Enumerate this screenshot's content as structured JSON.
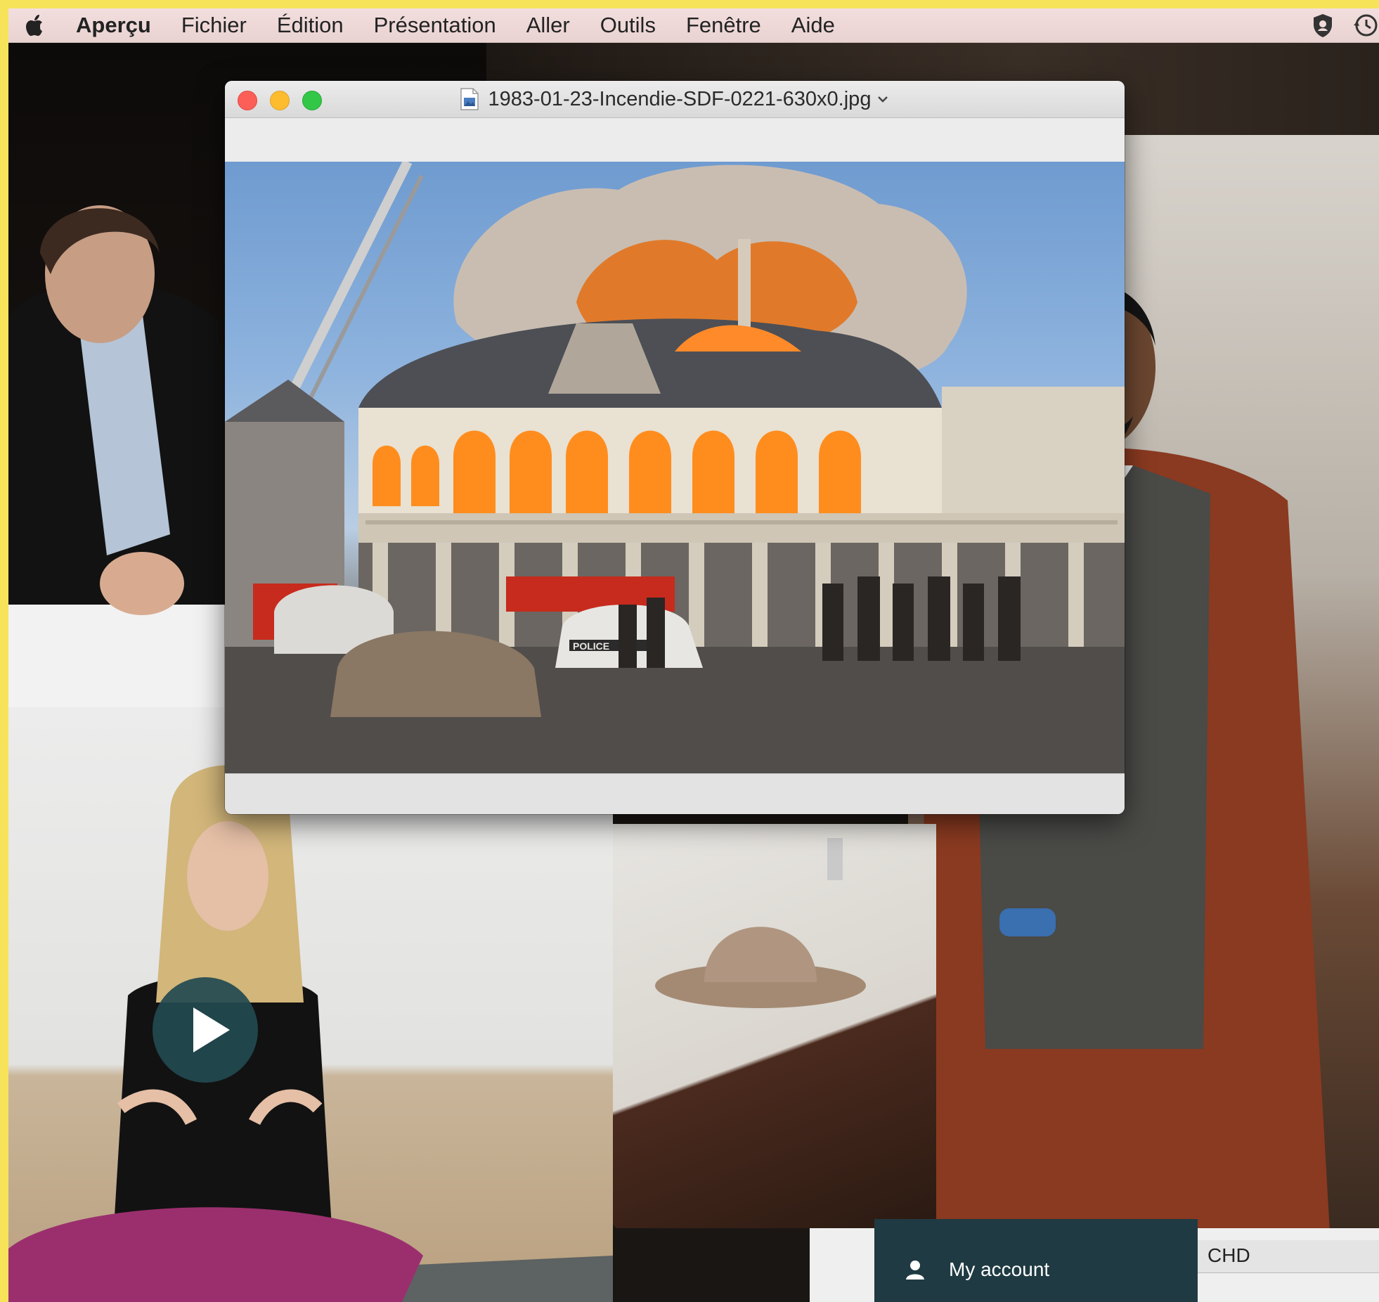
{
  "menubar": {
    "apple_icon": "apple-logo-icon",
    "app_name": "Aperçu",
    "items": [
      "Fichier",
      "Édition",
      "Présentation",
      "Aller",
      "Outils",
      "Fenêtre",
      "Aide"
    ],
    "status_icons": [
      "shield-icon",
      "time-machine-icon"
    ]
  },
  "preview_window": {
    "title": "1983-01-23-Incendie-SDF-0221-630x0.jpg",
    "doc_icon": "image-file-icon",
    "title_menu_icon": "chevron-down-icon",
    "traffic_lights": {
      "close": "#fc5f57",
      "minimize": "#fdbc2e",
      "zoom": "#33c748"
    },
    "photo_sign_text": "POLICE"
  },
  "video_tiles": {
    "play_icon": "play-icon",
    "play_color": "#224a50"
  },
  "account_menu": {
    "label": "My account",
    "icon": "user-icon",
    "background": "#1f3a42"
  },
  "right_strip": {
    "text": "CHD"
  },
  "colors": {
    "frame": "#f7e35a",
    "menubar": "#efdad9"
  }
}
